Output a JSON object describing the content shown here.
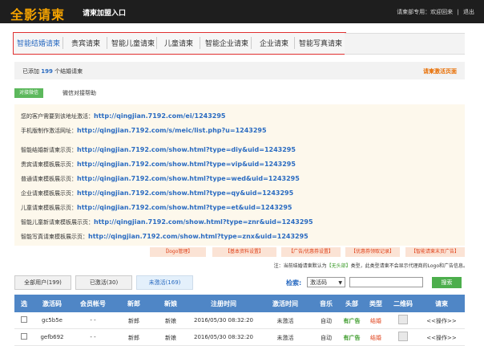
{
  "header": {
    "logo": "全影请柬",
    "title": "请柬加盟入口",
    "user_text": "请柬部专用：欢迎回来",
    "divider": "|",
    "logout": "退出"
  },
  "tabs": [
    {
      "label": "智能结婚请柬",
      "active": true
    },
    {
      "label": "贵宾请柬"
    },
    {
      "label": "智能儿童请柬"
    },
    {
      "label": "儿童请柬"
    },
    {
      "label": "智能企业请柬"
    },
    {
      "label": "企业请柬"
    },
    {
      "label": "智能写真请柬"
    }
  ],
  "info": {
    "prefix": "已添加",
    "count": "199",
    "suffix": "个结婚请柬",
    "activate_link": "请柬激活页面"
  },
  "wechat": {
    "button": "对接微信",
    "help": "微信对接帮助"
  },
  "urls": [
    {
      "label": "您的客户需要到该地址激活：",
      "value": "http://qingjian.7192.com/ei/1243295"
    },
    {
      "label": "手机版制作激活网址：",
      "value": "http://qingjian.7192.com/s/meic/list.php?u=1243295"
    },
    {
      "label": "智能结婚新请柬示页：",
      "value": "http://qingjian.7192.com/show.html?type=diy&uid=1243295"
    },
    {
      "label": "贵宾请柬模板展示页：",
      "value": "http://qingjian.7192.com/show.html?type=vip&uid=1243295"
    },
    {
      "label": "普通请柬模板展示页：",
      "value": "http://qingjian.7192.com/show.html?type=wed&uid=1243295"
    },
    {
      "label": "企业请柬模板展示页：",
      "value": "http://qingjian.7192.com/show.html?type=qy&uid=1243295"
    },
    {
      "label": "儿童请柬模板展示页：",
      "value": "http://qingjian.7192.com/show.html?type=et&uid=1243295"
    },
    {
      "label": "智能儿童新请柬模板展示页：",
      "value": "http://qingjian.7192.com/show.html?type=znr&uid=1243295"
    },
    {
      "label": "智能写真请柬模板展示页：",
      "value": "http://qingjian.7192.com/show.html?type=znx&uid=1243295"
    }
  ],
  "action_buttons": [
    "【logo管理】",
    "【基本资料设置】",
    "【广告/优惠券设置】",
    "【优惠券领取记录】",
    "【智能请柬末页广告】"
  ],
  "note": {
    "prefix": "注：当前结婚请柬默认为",
    "highlight": "【无头部】",
    "suffix": "类型，此类型请柬不会显示代理商的Logo和广告信息。"
  },
  "filter_tabs": [
    {
      "label": "全部用户(199)"
    },
    {
      "label": "已激活(30)"
    },
    {
      "label": "未激活(169)",
      "active": true
    }
  ],
  "search": {
    "label": "检索:",
    "select_value": "激活码",
    "button": "搜索"
  },
  "table": {
    "headers": [
      "选",
      "激活码",
      "会员帐号",
      "新郎",
      "新娘",
      "注册时间",
      "激活时间",
      "音乐",
      "头部",
      "类型",
      "二维码",
      "请柬"
    ],
    "rows": [
      {
        "code": "gc5b5e",
        "account": "- -",
        "groom": "新郎",
        "bride": "新娘",
        "reg": "2016/05/30 08:32:20",
        "act": "未激活",
        "music": "自动",
        "head": "有广告",
        "type": "结婚",
        "op": "<<操作>>"
      },
      {
        "code": "gefb692",
        "account": "- -",
        "groom": "新郎",
        "bride": "新娘",
        "reg": "2016/05/30 08:32:20",
        "act": "未激活",
        "music": "自动",
        "head": "有广告",
        "type": "结婚",
        "op": "<<操作>>"
      }
    ]
  },
  "colors": {
    "header_bg": "#1e1e1e",
    "logo": "#f5a300",
    "link_blue": "#2a6bc1",
    "table_head": "#4f86c6",
    "tab_border": "#e03030"
  }
}
